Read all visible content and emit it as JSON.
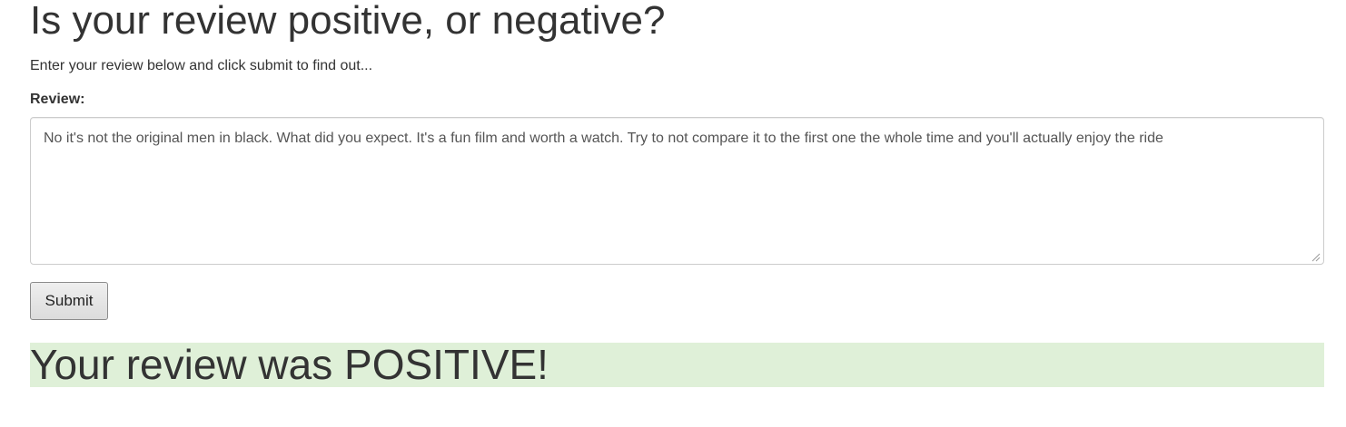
{
  "header": {
    "title": "Is your review positive, or negative?",
    "intro": "Enter your review below and click submit to find out..."
  },
  "form": {
    "review_label": "Review:",
    "review_value": "No it's not the original men in black. What did you expect. It's a fun film and worth a watch. Try to not compare it to the first one the whole time and you'll actually enjoy the ride",
    "submit_label": "Submit"
  },
  "result": {
    "message": "Your review was POSITIVE!",
    "background_color": "#dff0d8"
  }
}
